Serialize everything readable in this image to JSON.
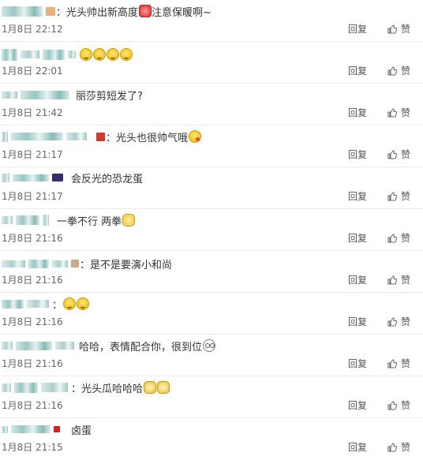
{
  "labels": {
    "reply": "回复",
    "like": "赞"
  },
  "comments": [
    {
      "text": "光头帅出新高度",
      "text_after": "注意保暖啊~",
      "date": "1月8日 22:12",
      "emojis": [
        "red-face-icon"
      ],
      "badge_color": "#e7b27a"
    },
    {
      "text": "",
      "text_after": "",
      "date": "1月8日 22:01",
      "emojis": [
        "laugh-cry-icon",
        "laugh-cry-icon",
        "laugh-cry-icon",
        "laugh-cry-icon"
      ],
      "badge_color": ""
    },
    {
      "text": "丽莎剪短发了?",
      "text_after": "",
      "date": "1月8日 21:42",
      "emojis": [],
      "badge_color": ""
    },
    {
      "text": "光头也很帅气哦",
      "text_after": "",
      "date": "1月8日 21:17",
      "emojis": [
        "kiss-face-icon"
      ],
      "badge_color": "#d33a2c"
    },
    {
      "text": "会反光的恐龙蛋",
      "text_after": "",
      "date": "1月8日 21:17",
      "emojis": [],
      "badge_color": "#3b2d6b"
    },
    {
      "text": "一拳不行 两拳",
      "text_after": "",
      "date": "1月8日 21:16",
      "emojis": [
        "fist-icon"
      ],
      "badge_color": ""
    },
    {
      "text": "是不是要演小和尚",
      "text_after": "",
      "date": "1月8日 21:16",
      "emojis": [],
      "badge_color": "#c9a88e"
    },
    {
      "text": "",
      "text_after": "",
      "date": "1月8日 21:16",
      "emojis": [
        "smile-icon",
        "smile-icon"
      ],
      "badge_color": ""
    },
    {
      "text": "哈哈，表情配合你，很到位",
      "text_after": "",
      "date": "1月8日 21:16",
      "emojis": [
        "glasses-face-icon"
      ],
      "badge_color": ""
    },
    {
      "text": "光头瓜哈哈哈",
      "text_after": "",
      "date": "1月8日 21:16",
      "emojis": [
        "doge-icon",
        "doge-icon"
      ],
      "badge_color": ""
    },
    {
      "text": "卤蛋",
      "text_after": "",
      "date": "1月8日 21:15",
      "emojis": [],
      "badge_color": "#d32020"
    }
  ]
}
